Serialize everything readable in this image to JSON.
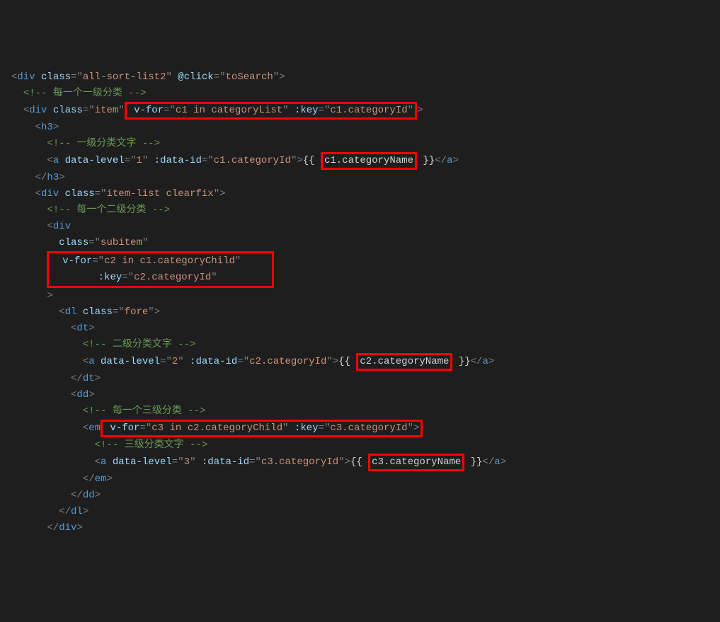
{
  "code": {
    "l1": {
      "tag": "div",
      "attr_class": "class",
      "val_class": "all-sort-list2",
      "attr_click": "@click",
      "val_click": "toSearch"
    },
    "l2": {
      "comment": "<!-- 每一个一级分类 -->"
    },
    "l3": {
      "tag": "div",
      "attr_class": "class",
      "val_class": "item",
      "attr_vfor": "v-for",
      "val_vfor": "c1 in categoryList",
      "attr_key": ":key",
      "val_key": "c1.categoryId"
    },
    "l4": {
      "tag": "h3"
    },
    "l5": {
      "comment": "<!-- 一级分类文字 -->"
    },
    "l6": {
      "tag": "a",
      "attr_dl": "data-level",
      "val_dl": "1",
      "attr_did": ":data-id",
      "val_did": "c1.categoryId",
      "open": "{{",
      "expr": "c1.categoryName",
      "close": "}}"
    },
    "l7": {
      "tag": "h3"
    },
    "l8": {
      "tag": "div",
      "attr_class": "class",
      "val_class": "item-list clearfix"
    },
    "l9": {
      "comment": "<!-- 每一个二级分类 -->"
    },
    "l10": {
      "tag": "div"
    },
    "l11": {
      "attr": "class",
      "val": "subitem"
    },
    "l12": {
      "attr": "v-for",
      "val": "c2 in c1.categoryChild"
    },
    "l13": {
      "attr": ":key",
      "val": "c2.categoryId"
    },
    "l15": {
      "tag": "dl",
      "attr_class": "class",
      "val_class": "fore"
    },
    "l16": {
      "tag": "dt"
    },
    "l17": {
      "comment": "<!-- 二级分类文字 -->"
    },
    "l18": {
      "tag": "a",
      "attr_dl": "data-level",
      "val_dl": "2",
      "attr_did": ":data-id",
      "val_did": "c2.categoryId",
      "open": "{{",
      "expr": "c2.categoryName",
      "close": "}}"
    },
    "l19": {
      "tag": "dt"
    },
    "l20": {
      "tag": "dd"
    },
    "l21": {
      "comment": "<!-- 每一个三级分类 -->"
    },
    "l22": {
      "tag": "em",
      "attr_vfor": "v-for",
      "val_vfor": "c3 in c2.categoryChild",
      "attr_key": ":key",
      "val_key": "c3.categoryId"
    },
    "l23": {
      "comment": "<!-- 三级分类文字 -->"
    },
    "l24": {
      "tag": "a",
      "attr_dl": "data-level",
      "val_dl": "3",
      "attr_did": ":data-id",
      "val_did": "c3.categoryId",
      "open": "{{",
      "expr": "c3.categoryName",
      "close": "}}"
    },
    "l25": {
      "tag": "em"
    },
    "l26": {
      "tag": "dd"
    },
    "l27": {
      "tag": "dl"
    },
    "l28": {
      "tag": "div"
    }
  }
}
